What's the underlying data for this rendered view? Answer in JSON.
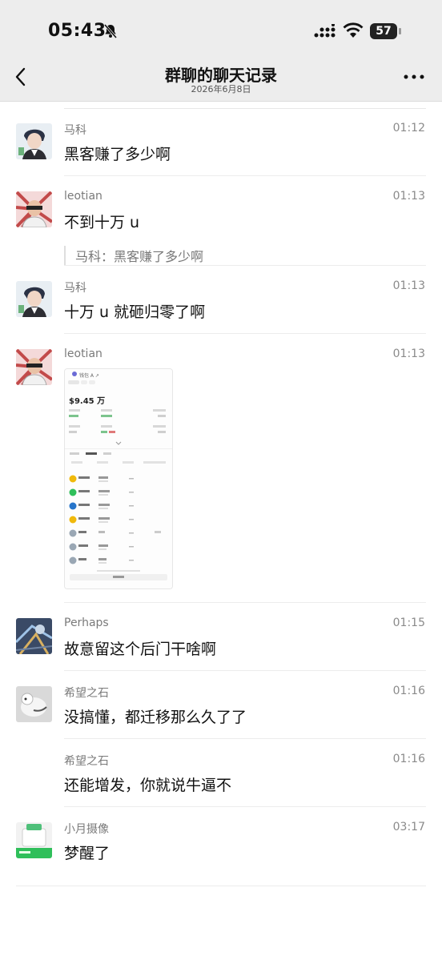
{
  "status_bar": {
    "time": "05:43",
    "battery": "57"
  },
  "header": {
    "title": "群聊的聊天记录",
    "date": "2026年6月8日"
  },
  "colors": {
    "header_bg": "#ededed",
    "accent_green": "#2fbf5a"
  },
  "messages": [
    {
      "name": "马科",
      "time": "01:12",
      "text": "黑客赚了多少啊"
    },
    {
      "name": "leotian",
      "time": "01:13",
      "text": "不到十万 u",
      "quote": "马科：黑客赚了多少啊"
    },
    {
      "name": "马科",
      "time": "01:13",
      "text": "十万 u 就砸归零了啊"
    },
    {
      "name": "leotian",
      "time": "01:13",
      "image": {
        "amount": "$9.45 万",
        "header": "钱包 A ↗"
      }
    },
    {
      "name": "Perhaps",
      "time": "01:15",
      "text": "故意留这个后门干啥啊"
    },
    {
      "name": "希望之石",
      "time": "01:16",
      "text": "没搞懂，都迁移那么久了了"
    },
    {
      "name": "希望之石",
      "time": "01:16",
      "text": "还能增发，你就说牛逼不"
    },
    {
      "name": "小月摄像",
      "time": "03:17",
      "text": "梦醒了"
    }
  ]
}
